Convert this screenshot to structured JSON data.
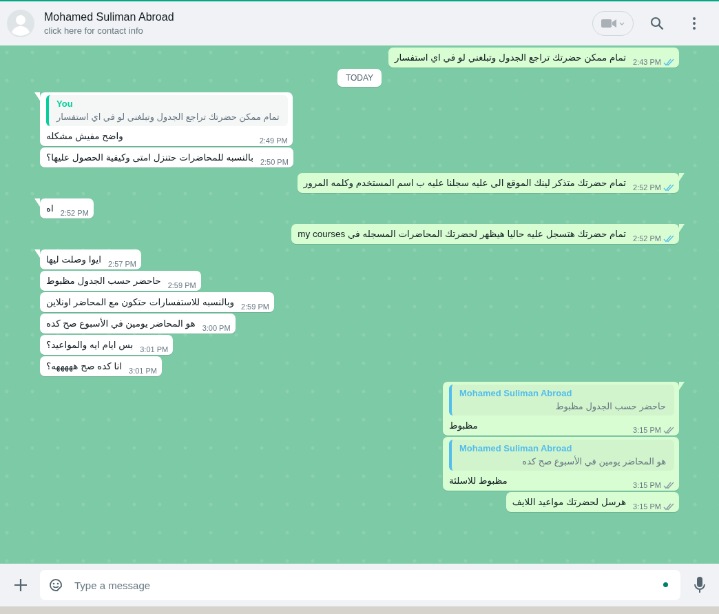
{
  "header": {
    "name": "Mohamed Suliman Abroad",
    "subtitle": "click here for contact info"
  },
  "messages": [
    {
      "kind": "sent",
      "tail": false,
      "text": "تمام ممكن حضرتك تراجع الجدول وتبلغني لو في اي استفسار",
      "time": "2:43 PM",
      "read": true
    },
    {
      "kind": "date",
      "text": "TODAY"
    },
    {
      "kind": "received",
      "tail": true,
      "quote": {
        "author": "You",
        "text": "تمام ممكن حضرتك تراجع الجدول وتبلغني لو في اي استفسار"
      },
      "text": "واضح مفيش مشكله",
      "time": "2:49 PM"
    },
    {
      "kind": "received",
      "tail": false,
      "text": "بالنسبه للمحاضرات حتنزل امتى وكيفية الحصول عليها؟",
      "time": "2:50 PM"
    },
    {
      "kind": "sent",
      "tail": true,
      "text": "تمام حضرتك متذكر لينك الموقع الي عليه سجلنا عليه ب اسم المستخدم وكلمه المرور",
      "time": "2:52 PM",
      "read": true
    },
    {
      "kind": "received",
      "tail": true,
      "text": "اه",
      "time": "2:52 PM"
    },
    {
      "kind": "sent",
      "tail": true,
      "text": "تمام حضرتك هتسجل عليه حاليا هيظهر لحضرتك المحاضرات المسجله في my courses",
      "time": "2:52 PM",
      "read": true
    },
    {
      "kind": "received",
      "tail": true,
      "text": "ايوا وصلت ليها",
      "time": "2:57 PM"
    },
    {
      "kind": "received",
      "tail": false,
      "text": "حاحضر حسب الجدول مظبوط",
      "time": "2:59 PM"
    },
    {
      "kind": "received",
      "tail": false,
      "text": "وبالنسبه للاستفسارات حتكون مع المحاضر اونلاين",
      "time": "2:59 PM"
    },
    {
      "kind": "received",
      "tail": false,
      "text": "هو المحاضر يومين في الأسبوع صح كده",
      "time": "3:00 PM"
    },
    {
      "kind": "received",
      "tail": false,
      "text": "بس ايام ايه والمواعيد؟",
      "time": "3:01 PM"
    },
    {
      "kind": "received",
      "tail": false,
      "text": "انا كده صح هههههه؟",
      "time": "3:01 PM"
    },
    {
      "kind": "sent",
      "tail": true,
      "quote": {
        "author": "Mohamed Suliman Abroad",
        "text": "حاحضر حسب الجدول مظبوط"
      },
      "text": "مظبوط",
      "time": "3:15 PM",
      "read": false
    },
    {
      "kind": "sent",
      "tail": false,
      "quote": {
        "author": "Mohamed Suliman Abroad",
        "text": "هو المحاضر يومين في الأسبوع صح كده"
      },
      "text": "مظبوط للاسلئة",
      "time": "3:15 PM",
      "read": false
    },
    {
      "kind": "sent",
      "tail": false,
      "text": "هرسل لحضرتك مواعيد اللايف",
      "time": "3:15 PM",
      "read": false
    }
  ],
  "composer": {
    "placeholder": "Type a message"
  }
}
